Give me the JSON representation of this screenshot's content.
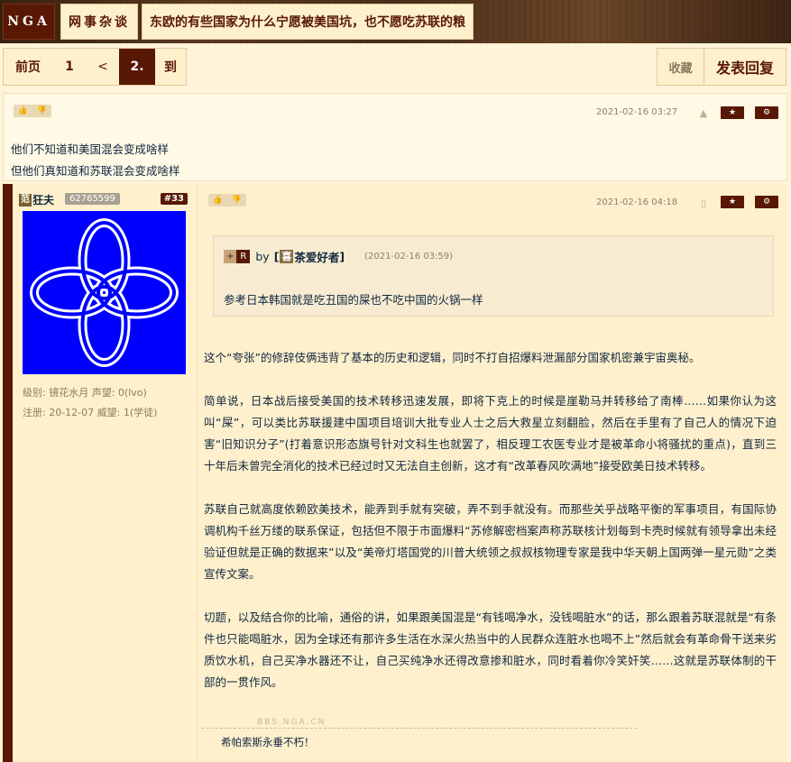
{
  "header": {
    "logo": "NGA",
    "board": "网事杂谈",
    "thread_title": "东欧的有些国家为什么宁愿被美国坑，也不愿吃苏联的粮"
  },
  "pager": {
    "first": "前页",
    "page1": "1",
    "prev": "<",
    "current": "2.",
    "goto": "到"
  },
  "actions": {
    "favorite": "收藏",
    "reply": "发表回复"
  },
  "post1": {
    "date": "2021-02-16 03:27",
    "device_icon": "android-icon",
    "lines": [
      "他们不知道和美国混会变成啥样",
      "但他们真知道和苏联混会变成啥样"
    ]
  },
  "post2": {
    "user": {
      "tag": "范",
      "name": "狂夫",
      "uid": "62765599"
    },
    "floor": "#33",
    "level_line": "级别: 镜花水月   声望: 0(lvo)",
    "reg_line": "注册: 20-12-07 威望: 1(学徒)",
    "date": "2021-02-16 04:18",
    "device_icon": "phone-icon",
    "quote": {
      "plus": "+",
      "r": "R",
      "by": "by",
      "user_tag": "喜",
      "user": "茶爱好者",
      "date": "(2021-02-16 03:59)",
      "text": "参考日本韩国就是吃丑国的屎也不吃中国的火锅一样"
    },
    "paragraphs": [
      "这个“夸张”的修辞伎俩违背了基本的历史和逻辑，同时不打自招爆料泄漏部分国家机密兼宇宙奥秘。",
      "简单说，日本战后接受美国的技术转移迅速发展，即将下克上的时候是崖勒马并转移给了南棒……如果你认为这叫“屎”，可以类比苏联援建中国项目培训大批专业人士之后大救星立刻翻脸，然后在手里有了自己人的情况下迫害“旧知识分子”(打着意识形态旗号针对文科生也就罢了，相反理工农医专业才是被革命小将骚扰的重点)，直到三十年后未曾完全消化的技术已经过时又无法自主创新，这才有“改革春风吹满地”接受欧美日技术转移。",
      "苏联自己就高度依赖欧美技术，能弄到手就有突破，弄不到手就没有。而那些关乎战略平衡的军事项目，有国际协调机构千丝万缕的联系保证，包括但不限于市面爆料“苏修解密档案声称苏联核计划每到卡壳时候就有领导拿出未经验证但就是正确的数据来”以及“美帝灯塔国党的川普大统领之叔叔核物理专家是我中华天朝上国两弹一星元勋”之类宣传文案。",
      "切题，以及结合你的比喻，通俗的讲，如果跟美国混是“有钱喝净水，没钱喝脏水”的话，那么跟着苏联混就是“有条件也只能喝脏水，因为全球还有那许多生活在水深火热当中的人民群众连脏水也喝不上”然后就会有革命骨干送来劣质饮水机，自己买净水器还不让，自己买纯净水还得改意掺和脏水，同时看着你冷笑奸笑……这就是苏联体制的干部的一贯作风。"
    ],
    "watermark": "BBS.NGA.CN",
    "signature": "希帕索斯永垂不朽！"
  }
}
